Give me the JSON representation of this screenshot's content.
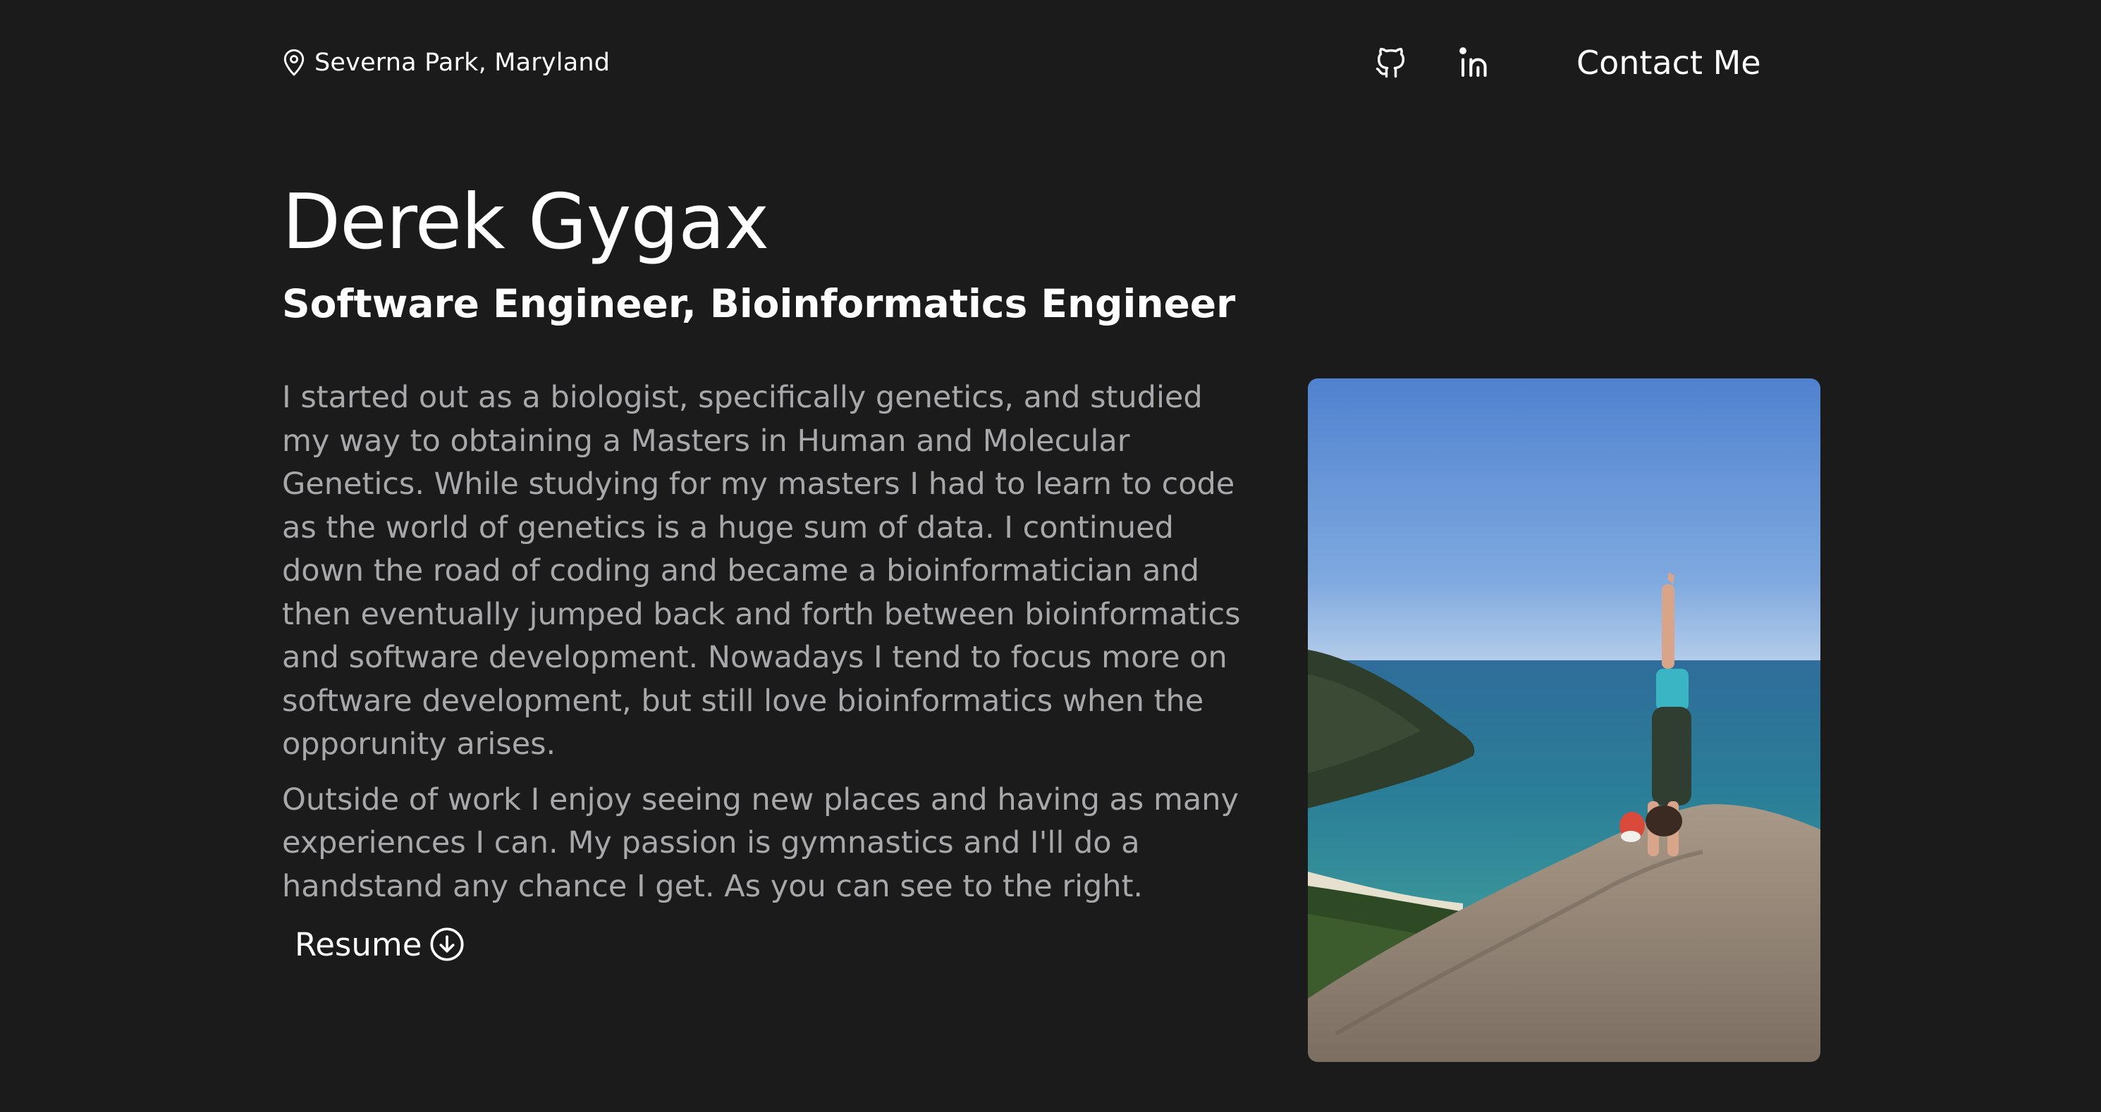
{
  "header": {
    "location": "Severna Park, Maryland",
    "location_icon": "map-pin-icon",
    "github_icon": "github-icon",
    "linkedin_icon": "linkedin-icon",
    "contact_label": "Contact Me"
  },
  "hero": {
    "name": "Derek Gygax",
    "title": "Software Engineer, Bioinformatics Engineer"
  },
  "bio": {
    "paragraph_1": "I started out as a biologist, specifically genetics, and studied my way to obtaining a Masters in Human and Molecular Genetics. While studying for my masters I had to learn to code as the world of genetics is a huge sum of data. I continued down the road of coding and became a bioinformatician and then eventually jumped back and forth between bioinformatics and software development. Nowadays I tend to focus more on software development, but still love bioinformatics when the opporunity arises.",
    "paragraph_2": "Outside of work I enjoy seeing new places and having as many experiences I can. My passion is gymnastics and I'll do a handstand any chance I get. As you can see to the right."
  },
  "resume": {
    "label": "Resume",
    "icon": "download-circle-icon"
  },
  "photo": {
    "subject": "handstand-photo"
  },
  "colors": {
    "background": "#1b1b1b",
    "text_primary": "#ffffff",
    "text_muted": "#a8a8ab"
  }
}
